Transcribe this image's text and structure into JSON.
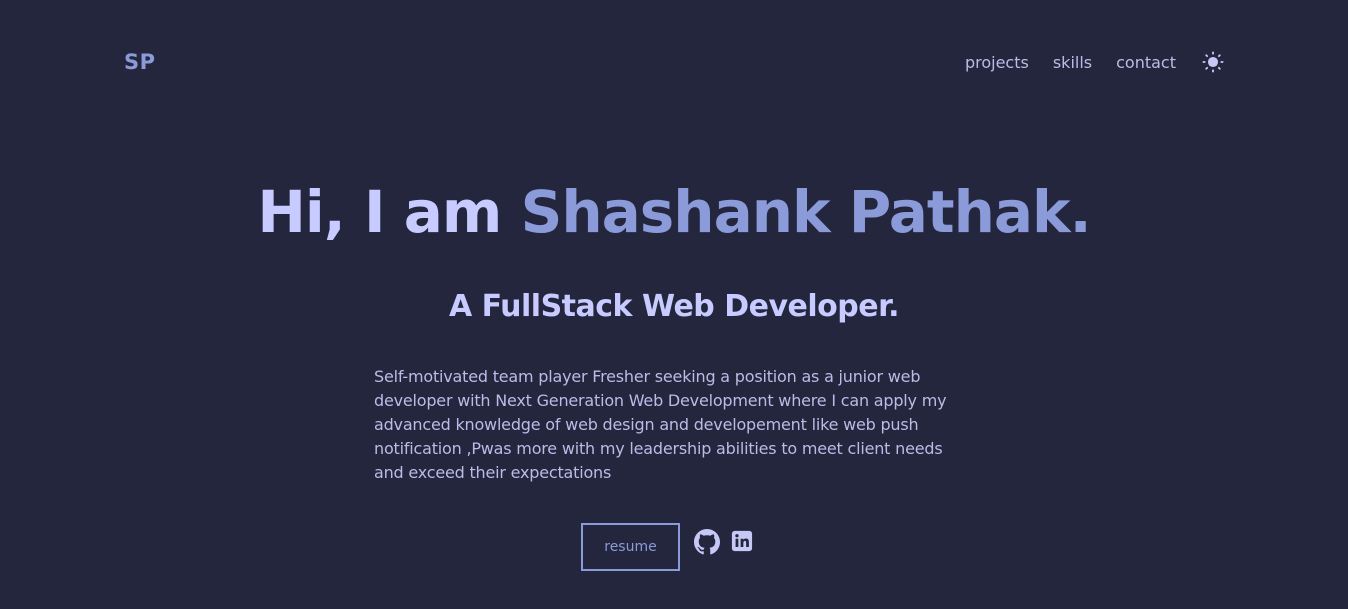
{
  "header": {
    "logo": "SP",
    "nav": [
      "projects",
      "skills",
      "contact"
    ],
    "theme_toggle_icon": "sun-icon"
  },
  "hero": {
    "greeting": "Hi, I am",
    "name": "Shashank Pathak.",
    "role": "A FullStack Web Developer.",
    "about": "Self-motivated team player Fresher seeking a position as a junior web developer with Next Generation Web Development where I can apply my advanced knowledge of web design and developement like web push notification ,Pwas more with my leadership abilities to meet client needs and exceed their expectations"
  },
  "actions": {
    "resume_label": "resume",
    "social_icons": [
      "github-icon",
      "linkedin-icon"
    ]
  },
  "colors": {
    "background": "#23263d",
    "accent": "#8b9ad8",
    "heading": "#c8cbff",
    "text": "#b9bde6"
  }
}
